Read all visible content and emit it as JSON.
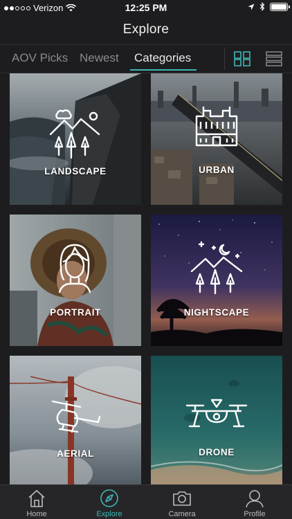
{
  "status": {
    "carrier": "Verizon",
    "time": "12:25 PM"
  },
  "header": {
    "title": "Explore"
  },
  "tabs": [
    {
      "label": "AOV Picks"
    },
    {
      "label": "Newest"
    },
    {
      "label": "Categories"
    }
  ],
  "categories": [
    {
      "label": "LANDSCAPE",
      "icon": "mountains-trees-icon"
    },
    {
      "label": "URBAN",
      "icon": "building-icon"
    },
    {
      "label": "PORTRAIT",
      "icon": "person-icon"
    },
    {
      "label": "NIGHTSCAPE",
      "icon": "night-mountains-icon"
    },
    {
      "label": "AERIAL",
      "icon": "helicopter-icon"
    },
    {
      "label": "DRONE",
      "icon": "drone-icon"
    }
  ],
  "tabbar": [
    {
      "label": "Home",
      "icon": "home-icon"
    },
    {
      "label": "Explore",
      "icon": "compass-icon"
    },
    {
      "label": "Camera",
      "icon": "camera-icon"
    },
    {
      "label": "Profile",
      "icon": "profile-icon"
    }
  ],
  "colors": {
    "accent": "#3fb7b5",
    "background": "#1d1d1f",
    "tabbar": "#262628"
  }
}
